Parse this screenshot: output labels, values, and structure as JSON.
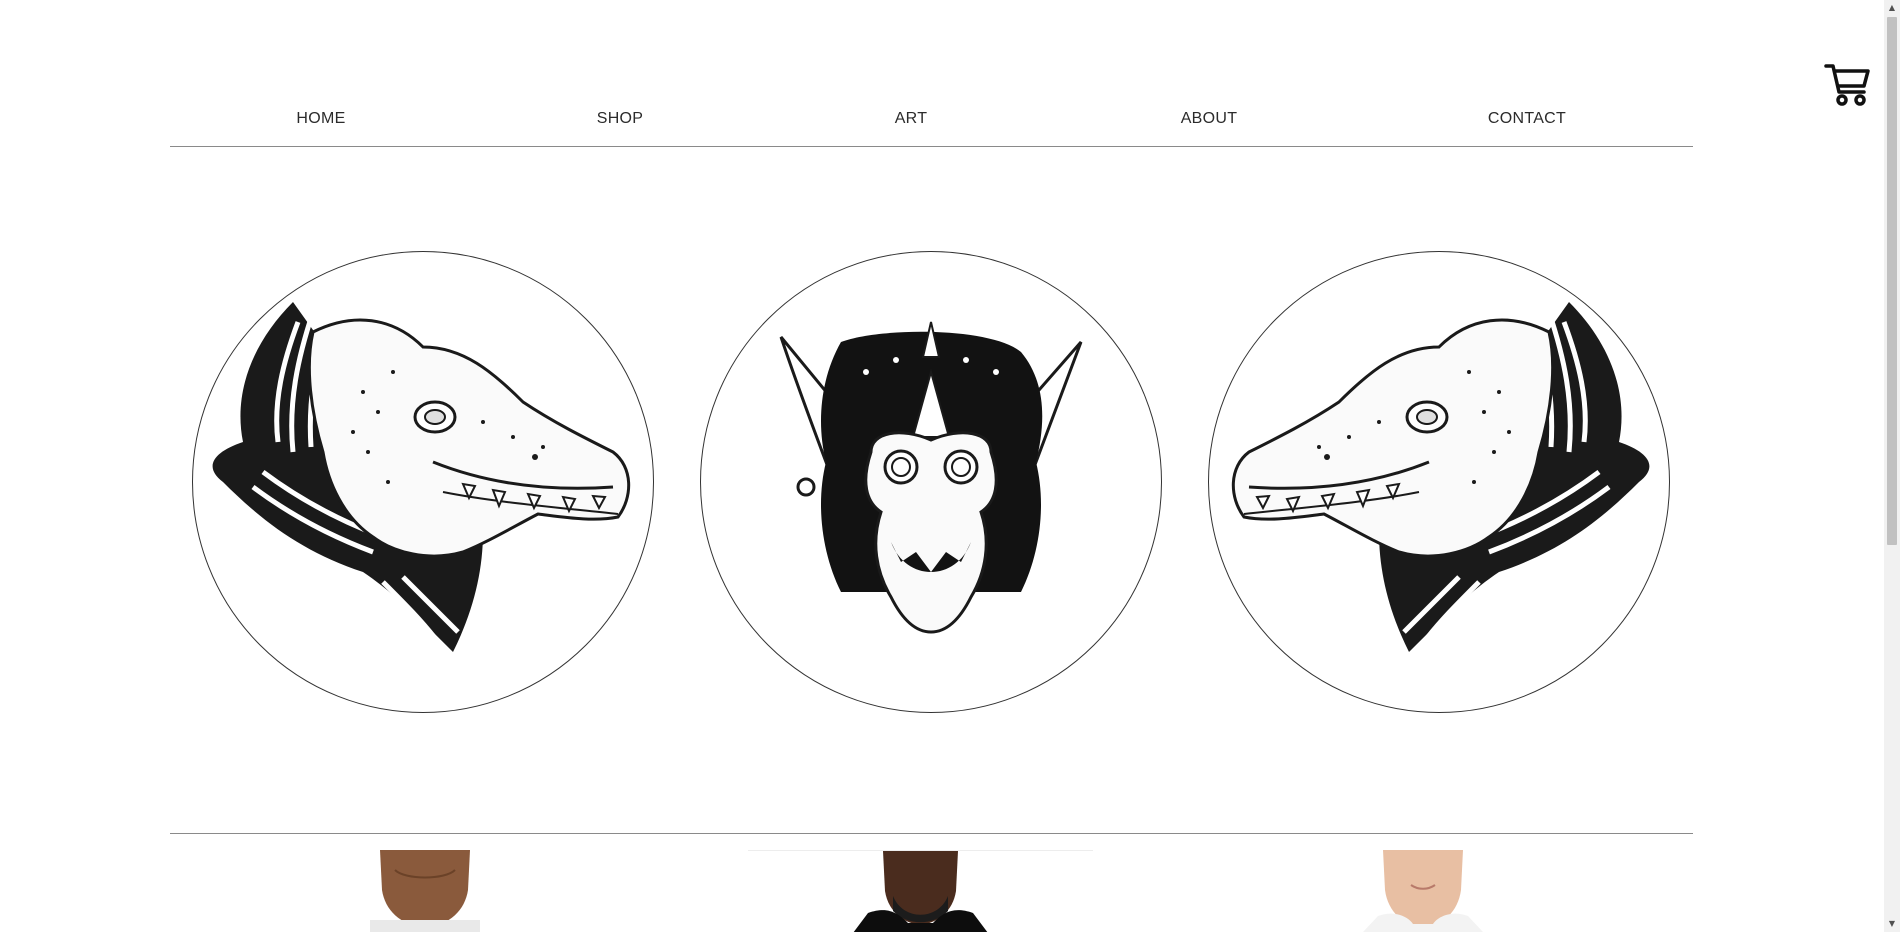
{
  "nav": {
    "items": [
      {
        "label": "HOME"
      },
      {
        "label": "SHOP"
      },
      {
        "label": "ART"
      },
      {
        "label": "ABOUT"
      },
      {
        "label": "CONTACT"
      }
    ]
  },
  "header": {
    "cart_icon": "shopping-cart-icon"
  },
  "gallery": {
    "images": [
      {
        "subject": "crocodile-head-illustration"
      },
      {
        "subject": "horned-skull-creature-illustration"
      },
      {
        "subject": "crocodile-head-illustration-mirrored"
      }
    ]
  },
  "products": {
    "items": [
      {
        "subject": "model-back-view-shirt"
      },
      {
        "subject": "model-black-hoodie"
      },
      {
        "subject": "model-white-tshirt"
      }
    ]
  },
  "colors": {
    "text": "#2b2b2b",
    "divider": "#8a8a8a",
    "ink": "#1a1a1a",
    "background": "#ffffff"
  }
}
